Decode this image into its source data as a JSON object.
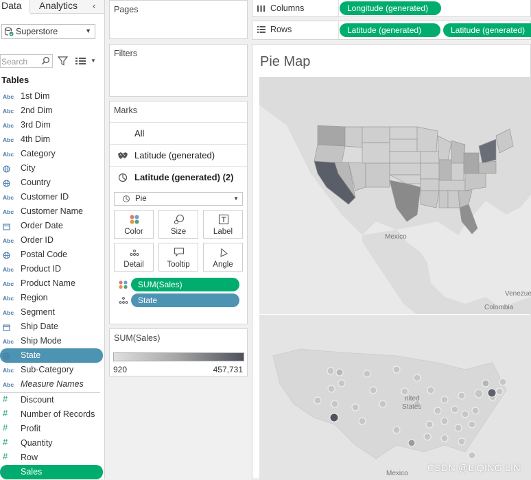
{
  "tabs": {
    "data": "Data",
    "analytics": "Analytics",
    "collapse": "‹"
  },
  "datasource": {
    "name": "Superstore"
  },
  "search": {
    "placeholder": "Search"
  },
  "tables_heading": "Tables",
  "fields": [
    {
      "type": "Abc",
      "label": "1st Dim",
      "kind": "dim",
      "state": ""
    },
    {
      "type": "Abc",
      "label": "2nd Dim",
      "kind": "dim",
      "state": ""
    },
    {
      "type": "Abc",
      "label": "3rd Dim",
      "kind": "dim",
      "state": ""
    },
    {
      "type": "Abc",
      "label": "4th Dim",
      "kind": "dim",
      "state": ""
    },
    {
      "type": "Abc",
      "label": "Category",
      "kind": "dim",
      "state": ""
    },
    {
      "type": "geo",
      "label": "City",
      "kind": "dim",
      "state": ""
    },
    {
      "type": "geo",
      "label": "Country",
      "kind": "dim",
      "state": ""
    },
    {
      "type": "Abc",
      "label": "Customer ID",
      "kind": "dim",
      "state": ""
    },
    {
      "type": "Abc",
      "label": "Customer Name",
      "kind": "dim",
      "state": ""
    },
    {
      "type": "date",
      "label": "Order Date",
      "kind": "dim",
      "state": ""
    },
    {
      "type": "Abc",
      "label": "Order ID",
      "kind": "dim",
      "state": ""
    },
    {
      "type": "geo",
      "label": "Postal Code",
      "kind": "dim",
      "state": ""
    },
    {
      "type": "Abc",
      "label": "Product ID",
      "kind": "dim",
      "state": ""
    },
    {
      "type": "Abc",
      "label": "Product Name",
      "kind": "dim",
      "state": ""
    },
    {
      "type": "Abc",
      "label": "Region",
      "kind": "dim",
      "state": ""
    },
    {
      "type": "Abc",
      "label": "Segment",
      "kind": "dim",
      "state": ""
    },
    {
      "type": "date",
      "label": "Ship Date",
      "kind": "dim",
      "state": ""
    },
    {
      "type": "Abc",
      "label": "Ship Mode",
      "kind": "dim",
      "state": ""
    },
    {
      "type": "geo",
      "label": "State",
      "kind": "dim",
      "state": "selected-blue"
    },
    {
      "type": "Abc",
      "label": "Sub-Category",
      "kind": "dim",
      "state": ""
    },
    {
      "type": "Abc",
      "label": "Measure Names",
      "kind": "dim",
      "state": "italic"
    },
    {
      "type": "#",
      "label": "Discount",
      "kind": "measure",
      "state": ""
    },
    {
      "type": "#",
      "label": "Number of Records",
      "kind": "measure",
      "state": ""
    },
    {
      "type": "#",
      "label": "Profit",
      "kind": "measure",
      "state": ""
    },
    {
      "type": "#",
      "label": "Quantity",
      "kind": "measure",
      "state": ""
    },
    {
      "type": "#",
      "label": "Row",
      "kind": "measure",
      "state": ""
    },
    {
      "type": "#",
      "label": "Sales",
      "kind": "measure",
      "state": "selected-green"
    }
  ],
  "cards": {
    "pages": "Pages",
    "filters": "Filters",
    "marks": "Marks"
  },
  "marks": {
    "all": "All",
    "layer1": "Latitude (generated)",
    "layer2": "Latitude (generated) (2)",
    "mark_type": "Pie",
    "buttons": [
      "Color",
      "Size",
      "Label",
      "Detail",
      "Tooltip",
      "Angle"
    ],
    "pills": [
      {
        "label": "SUM(Sales)",
        "color": "#00ad6f",
        "icon": "color-dots-icon"
      },
      {
        "label": "State",
        "color": "#4d93b2",
        "icon": "detail-dots-icon"
      }
    ]
  },
  "legend": {
    "title": "SUM(Sales)",
    "min": "920",
    "max": "457,731",
    "color_low": "#dfdfdf",
    "color_high": "#4d515b"
  },
  "shelves": {
    "columns_label": "Columns",
    "rows_label": "Rows",
    "columns": [
      "Longitude (generated)"
    ],
    "rows": [
      "Latitude (generated)",
      "Latitude (generated)"
    ]
  },
  "view": {
    "title": "Pie Map",
    "map_labels": {
      "mexico_top": "Mexico",
      "colombia": "Colombia",
      "venezuela": "Venezue",
      "united_states": "nited\nStates",
      "mexico_bottom": "Mexico"
    }
  },
  "watermark": "CSDN @LIQING LIN",
  "colors": {
    "accent_green": "#00ad6f",
    "pill_blue": "#4d93b2",
    "dark_state": "#50545f"
  }
}
